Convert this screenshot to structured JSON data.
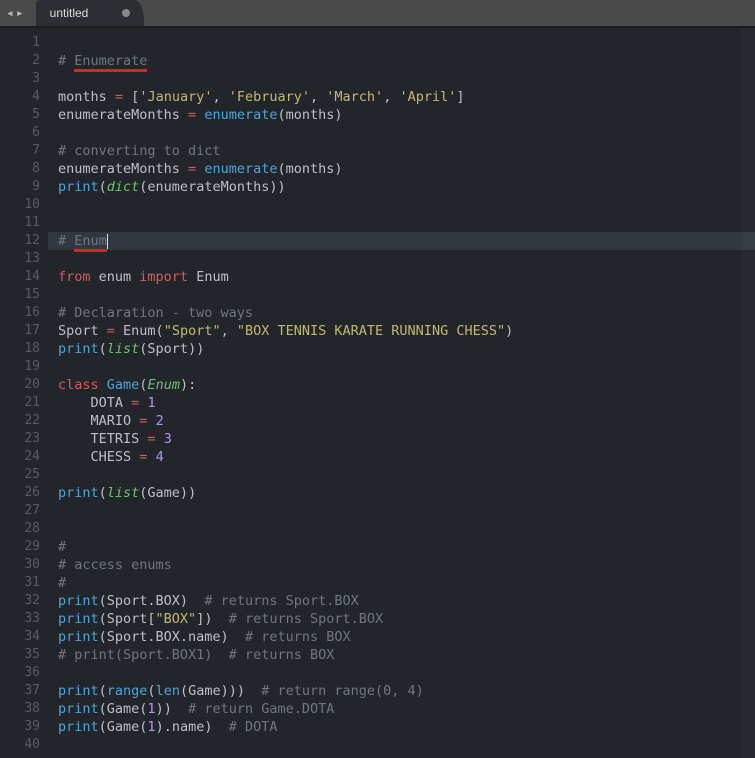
{
  "tab": {
    "title": "untitled",
    "dirty": true
  },
  "nav": {
    "left": "◂",
    "right": "▸"
  },
  "active_line": 12,
  "lines": [
    {
      "n": 1,
      "seg": []
    },
    {
      "n": 2,
      "seg": [
        [
          "c",
          "# "
        ],
        [
          "c ul",
          "Enumerate"
        ]
      ]
    },
    {
      "n": 3,
      "seg": []
    },
    {
      "n": 4,
      "seg": [
        [
          "p",
          "months "
        ],
        [
          "o",
          "="
        ],
        [
          "p",
          " ["
        ],
        [
          "s",
          "'January'"
        ],
        [
          "p",
          ", "
        ],
        [
          "s",
          "'February'"
        ],
        [
          "p",
          ", "
        ],
        [
          "s",
          "'March'"
        ],
        [
          "p",
          ", "
        ],
        [
          "s",
          "'April'"
        ],
        [
          "p",
          "]"
        ]
      ]
    },
    {
      "n": 5,
      "seg": [
        [
          "p",
          "enumerateMonths "
        ],
        [
          "o",
          "="
        ],
        [
          "p",
          " "
        ],
        [
          "f",
          "enumerate"
        ],
        [
          "p",
          "(months)"
        ]
      ]
    },
    {
      "n": 6,
      "seg": []
    },
    {
      "n": 7,
      "seg": [
        [
          "c",
          "# converting to dict"
        ]
      ]
    },
    {
      "n": 8,
      "seg": [
        [
          "p",
          "enumerateMonths "
        ],
        [
          "o",
          "="
        ],
        [
          "p",
          " "
        ],
        [
          "f",
          "enumerate"
        ],
        [
          "p",
          "(months)"
        ]
      ]
    },
    {
      "n": 9,
      "seg": [
        [
          "f",
          "print"
        ],
        [
          "p",
          "("
        ],
        [
          "t",
          "dict"
        ],
        [
          "p",
          "(enumerateMonths))"
        ]
      ]
    },
    {
      "n": 10,
      "seg": []
    },
    {
      "n": 11,
      "seg": []
    },
    {
      "n": 12,
      "seg": [
        [
          "c",
          "# "
        ],
        [
          "c ul",
          "Enum"
        ]
      ],
      "cursor": true
    },
    {
      "n": 13,
      "seg": []
    },
    {
      "n": 14,
      "seg": [
        [
          "k",
          "from"
        ],
        [
          "p",
          " enum "
        ],
        [
          "k",
          "import"
        ],
        [
          "p",
          " Enum"
        ]
      ]
    },
    {
      "n": 15,
      "seg": []
    },
    {
      "n": 16,
      "seg": [
        [
          "c",
          "# Declaration - two ways"
        ]
      ]
    },
    {
      "n": 17,
      "seg": [
        [
          "p",
          "Sport "
        ],
        [
          "o",
          "="
        ],
        [
          "p",
          " Enum("
        ],
        [
          "s",
          "\"Sport\""
        ],
        [
          "p",
          ", "
        ],
        [
          "s",
          "\"BOX TENNIS KARATE RUNNING CHESS\""
        ],
        [
          "p",
          ")"
        ]
      ]
    },
    {
      "n": 18,
      "seg": [
        [
          "f",
          "print"
        ],
        [
          "p",
          "("
        ],
        [
          "t",
          "list"
        ],
        [
          "p",
          "(Sport))"
        ]
      ]
    },
    {
      "n": 19,
      "seg": []
    },
    {
      "n": 20,
      "seg": [
        [
          "k",
          "class"
        ],
        [
          "p",
          " "
        ],
        [
          "f",
          "Game"
        ],
        [
          "p",
          "("
        ],
        [
          "t",
          "Enum"
        ],
        [
          "p",
          "):"
        ]
      ]
    },
    {
      "n": 21,
      "seg": [
        [
          "p",
          "    DOTA "
        ],
        [
          "o",
          "="
        ],
        [
          "p",
          " "
        ],
        [
          "n",
          "1"
        ]
      ]
    },
    {
      "n": 22,
      "seg": [
        [
          "p",
          "    MARIO "
        ],
        [
          "o",
          "="
        ],
        [
          "p",
          " "
        ],
        [
          "n",
          "2"
        ]
      ]
    },
    {
      "n": 23,
      "seg": [
        [
          "p",
          "    TETRIS "
        ],
        [
          "o",
          "="
        ],
        [
          "p",
          " "
        ],
        [
          "n",
          "3"
        ]
      ]
    },
    {
      "n": 24,
      "seg": [
        [
          "p",
          "    CHESS "
        ],
        [
          "o",
          "="
        ],
        [
          "p",
          " "
        ],
        [
          "n",
          "4"
        ]
      ]
    },
    {
      "n": 25,
      "seg": []
    },
    {
      "n": 26,
      "seg": [
        [
          "f",
          "print"
        ],
        [
          "p",
          "("
        ],
        [
          "t",
          "list"
        ],
        [
          "p",
          "(Game))"
        ]
      ]
    },
    {
      "n": 27,
      "seg": []
    },
    {
      "n": 28,
      "seg": []
    },
    {
      "n": 29,
      "seg": [
        [
          "c",
          "#"
        ]
      ]
    },
    {
      "n": 30,
      "seg": [
        [
          "c",
          "# access enums"
        ]
      ]
    },
    {
      "n": 31,
      "seg": [
        [
          "c",
          "#"
        ]
      ]
    },
    {
      "n": 32,
      "seg": [
        [
          "f",
          "print"
        ],
        [
          "p",
          "(Sport.BOX)  "
        ],
        [
          "c",
          "# returns Sport.BOX"
        ]
      ]
    },
    {
      "n": 33,
      "seg": [
        [
          "f",
          "print"
        ],
        [
          "p",
          "(Sport["
        ],
        [
          "s",
          "\"BOX\""
        ],
        [
          "p",
          "])  "
        ],
        [
          "c",
          "# returns Sport.BOX"
        ]
      ]
    },
    {
      "n": 34,
      "seg": [
        [
          "f",
          "print"
        ],
        [
          "p",
          "(Sport.BOX.name)  "
        ],
        [
          "c",
          "# returns BOX"
        ]
      ]
    },
    {
      "n": 35,
      "seg": [
        [
          "c",
          "# print(Sport.BOX1)  # returns BOX"
        ]
      ]
    },
    {
      "n": 36,
      "seg": []
    },
    {
      "n": 37,
      "seg": [
        [
          "f",
          "print"
        ],
        [
          "p",
          "("
        ],
        [
          "f",
          "range"
        ],
        [
          "p",
          "("
        ],
        [
          "f",
          "len"
        ],
        [
          "p",
          "(Game)))  "
        ],
        [
          "c",
          "# return range(0, 4)"
        ]
      ]
    },
    {
      "n": 38,
      "seg": [
        [
          "f",
          "print"
        ],
        [
          "p",
          "(Game("
        ],
        [
          "n",
          "1"
        ],
        [
          "p",
          "))  "
        ],
        [
          "c",
          "# return Game.DOTA"
        ]
      ]
    },
    {
      "n": 39,
      "seg": [
        [
          "f",
          "print"
        ],
        [
          "p",
          "(Game("
        ],
        [
          "n",
          "1"
        ],
        [
          "p",
          ").name)  "
        ],
        [
          "c",
          "# DOTA"
        ]
      ]
    },
    {
      "n": 40,
      "seg": []
    }
  ]
}
